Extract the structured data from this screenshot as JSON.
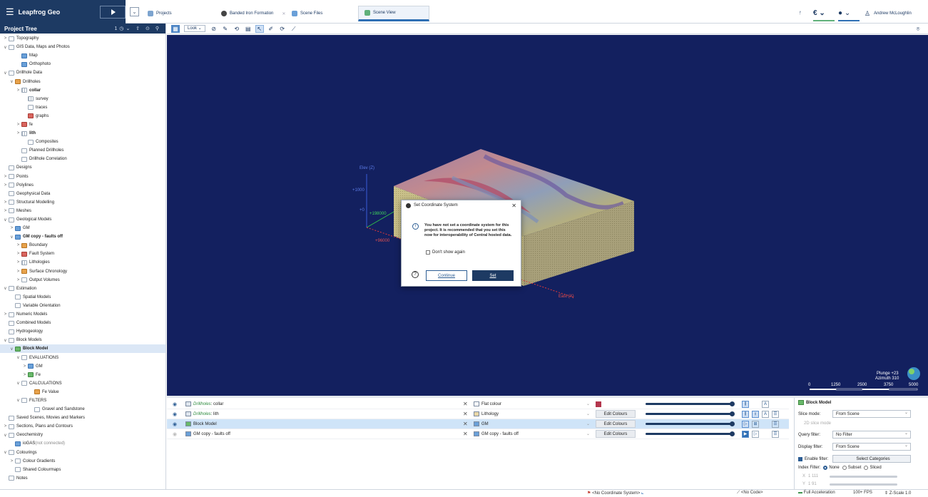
{
  "app": {
    "name": "Leapfrog Geo"
  },
  "tabs": [
    {
      "label": "Projects"
    },
    {
      "label": "Banded Iron Formation"
    },
    {
      "label": "Scene Files"
    },
    {
      "label": "Scene View"
    }
  ],
  "user": {
    "name": "Andrew McLoughlin"
  },
  "project_tree": {
    "title": "Project Tree",
    "items": [
      {
        "label": "Topography",
        "caret": ">"
      },
      {
        "label": "GIS Data, Maps and Photos",
        "caret": "v"
      },
      {
        "label": "Map"
      },
      {
        "label": "Orthophoto"
      },
      {
        "label": "Drillhole Data",
        "caret": "v"
      },
      {
        "label": "Drillholes",
        "caret": "v"
      },
      {
        "label": "collar",
        "caret": ">"
      },
      {
        "label": "survey"
      },
      {
        "label": "traces"
      },
      {
        "label": "graphs"
      },
      {
        "label": "fe",
        "caret": ">"
      },
      {
        "label": "lith",
        "caret": ">"
      },
      {
        "label": "Composites"
      },
      {
        "label": "Planned Drillholes"
      },
      {
        "label": "Drillhole Correlation"
      },
      {
        "label": "Designs"
      },
      {
        "label": "Points",
        "caret": ">"
      },
      {
        "label": "Polylines",
        "caret": ">"
      },
      {
        "label": "Geophysical Data"
      },
      {
        "label": "Structural Modelling",
        "caret": ">"
      },
      {
        "label": "Meshes",
        "caret": ">"
      },
      {
        "label": "Geological Models",
        "caret": "v"
      },
      {
        "label": "GM",
        "caret": ">"
      },
      {
        "label": "GM copy - faults off",
        "caret": "v"
      },
      {
        "label": "Boundary",
        "caret": ">"
      },
      {
        "label": "Fault System",
        "caret": ">"
      },
      {
        "label": "Lithologies",
        "caret": ">"
      },
      {
        "label": "Surface Chronology",
        "caret": ">"
      },
      {
        "label": "Output Volumes",
        "caret": ">"
      },
      {
        "label": "Estimation",
        "caret": "v"
      },
      {
        "label": "Spatial Models"
      },
      {
        "label": "Variable Orientation"
      },
      {
        "label": "Numeric Models",
        "caret": ">"
      },
      {
        "label": "Combined Models"
      },
      {
        "label": "Hydrogeology"
      },
      {
        "label": "Block Models",
        "caret": "v"
      },
      {
        "label": "Block Model",
        "caret": "v"
      },
      {
        "label": "EVALUATIONS",
        "caret": "v"
      },
      {
        "label": "GM",
        "caret": ">"
      },
      {
        "label": "Fe",
        "caret": ">"
      },
      {
        "label": "CALCULATIONS",
        "caret": "v"
      },
      {
        "label": "Fe Value"
      },
      {
        "label": "FILTERS",
        "caret": "v"
      },
      {
        "label": "Gravel and Sandstone"
      },
      {
        "label": "Saved Scenes, Movies and Markers"
      },
      {
        "label": "Sections, Plans and Contours",
        "caret": ">"
      },
      {
        "label": "Geochemistry",
        "caret": "v"
      },
      {
        "label": "ioGAS",
        "note": "(not connected)"
      },
      {
        "label": "Colourings",
        "caret": "v"
      },
      {
        "label": "Colour Gradients",
        "caret": ">"
      },
      {
        "label": "Shared Colourmaps"
      },
      {
        "label": "Notes"
      }
    ]
  },
  "scene_toolbar": {
    "look_label": "Look"
  },
  "scene": {
    "axis_elev": "Elev (Z)",
    "tick_z_1000": "+1000",
    "tick_z_0": "+0",
    "tick_y": "+198000",
    "tick_x": "+96000",
    "axis_east": "East (X)",
    "plunge": "Plunge +23",
    "azimuth": "Azimuth 310",
    "scale_labels": [
      "0",
      "1250",
      "2500",
      "3750",
      "5000"
    ]
  },
  "dialog": {
    "title": "Set Coordinate System",
    "message": "You have not set a coordinate system for this project. It is recommended that you set this now for interoperability of Central hosted data.",
    "dont_show": "Don't show again",
    "continue_label": "Continue",
    "set_label": "Set"
  },
  "shape_list": [
    {
      "prefix": "Drillholes",
      "name": ": collar",
      "colouring": "Flat colour",
      "edit": "",
      "visible": true
    },
    {
      "prefix": "Drillholes",
      "name": ": lith",
      "colouring": "Lithology",
      "edit": "Edit Colours",
      "visible": true
    },
    {
      "prefix": "",
      "name": "Block Model",
      "colouring": "GM",
      "edit": "Edit Colours",
      "visible": true
    },
    {
      "prefix": "",
      "name": "GM copy - faults off",
      "colouring": "GM copy - faults off",
      "edit": "Edit Colours",
      "visible": false
    }
  ],
  "properties": {
    "title": "Block Model",
    "slice_mode_label": "Slice mode:",
    "slice_mode_value": "From Scene",
    "slice_2d": "2D slice mode",
    "query_filter_label": "Query filter:",
    "query_filter_value": "No Filter",
    "display_filter_label": "Display filter:",
    "display_filter_value": "From Scene",
    "enable_filter_label": "Enable filter:",
    "select_categories": "Select Categories",
    "index_filter_label": "Index Filter:",
    "index_none": "None",
    "index_subset": "Subset",
    "index_sliced": "Sliced",
    "x_label": "X",
    "x_value": "1 111",
    "y_label": "Y",
    "y_value": "1 91"
  },
  "status": {
    "coord_system": "<No Coordinate System>",
    "code": "<No Code>",
    "acceleration": "Full Acceleration",
    "fps": "100+ FPS",
    "zscale": "Z-Scale 1.0"
  },
  "colors": {
    "brand": "#1d3a63",
    "scene_bg": "#13205f",
    "accent": "#2f6fb4"
  }
}
